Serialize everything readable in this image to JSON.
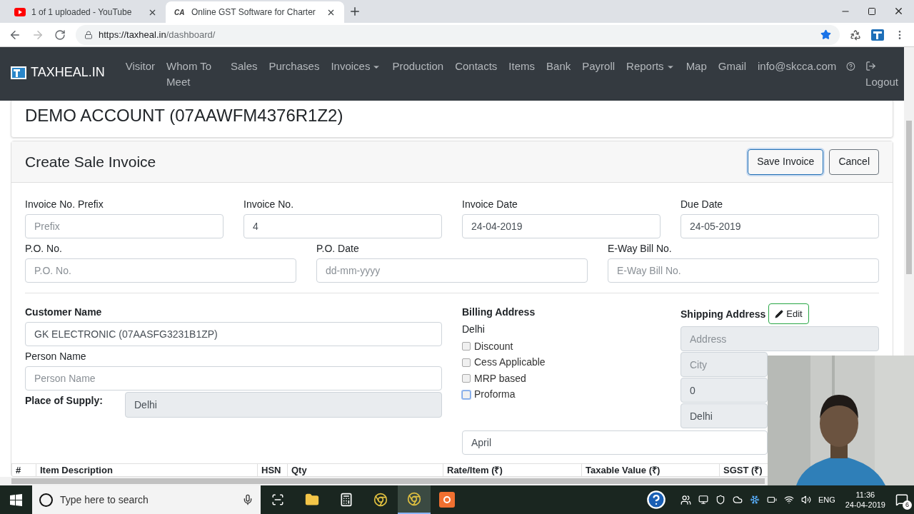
{
  "browser": {
    "tabs": [
      {
        "kind": "youtube",
        "title": "1 of 1 uploaded - YouTube",
        "selected": false
      },
      {
        "kind": "site",
        "favicon": "CA",
        "title": "Online GST Software for Charter",
        "selected": true
      }
    ],
    "address": {
      "host": "https://taxheal.in",
      "path": "/dashboard/"
    }
  },
  "navbar": {
    "brand": "TAXHEAL.IN",
    "items": [
      {
        "label": "Visitor",
        "dropdown": false
      },
      {
        "label": "Whom To Meet",
        "dropdown": false
      },
      {
        "label": "Sales",
        "dropdown": false
      },
      {
        "label": "Purchases",
        "dropdown": false
      },
      {
        "label": "Invoices",
        "dropdown": true
      },
      {
        "label": "Production",
        "dropdown": false
      },
      {
        "label": "Contacts",
        "dropdown": false
      },
      {
        "label": "Items",
        "dropdown": false
      },
      {
        "label": "Bank",
        "dropdown": false
      },
      {
        "label": "Payroll",
        "dropdown": false
      },
      {
        "label": "Reports",
        "dropdown": true
      },
      {
        "label": "Map",
        "dropdown": false
      },
      {
        "label": "Gmail",
        "dropdown": false
      },
      {
        "label": "info@skcca.com",
        "dropdown": false
      }
    ],
    "logout": "Logout"
  },
  "account_title": "DEMO ACCOUNT (07AAWFM4376R1Z2)",
  "invoice": {
    "title": "Create Sale Invoice",
    "buttons": [
      {
        "label": "Save Invoice",
        "kind": "primary"
      },
      {
        "label": "Cancel",
        "kind": "secondary"
      }
    ],
    "row_1": [
      {
        "label": "Invoice No. Prefix",
        "placeholder": "Prefix"
      },
      {
        "label": "Invoice No.",
        "value": "4"
      },
      {
        "label": "Invoice Date",
        "value": "24-04-2019"
      },
      {
        "label": "Due Date",
        "value": "24-05-2019"
      }
    ],
    "row_2": [
      {
        "label": "P.O. No.",
        "placeholder": "P.O. No."
      },
      {
        "label": "P.O. Date",
        "placeholder": "dd-mm-yyyy"
      },
      {
        "label": "E-Way Bill No.",
        "placeholder": "E-Way Bill No."
      }
    ],
    "customer": {
      "label": "Customer Name",
      "value": "GK ELECTRONIC (07AASFG3231B1ZP)",
      "person_label": "Person Name",
      "person_placeholder": "Person Name",
      "supply_label": "Place of Supply:",
      "supply_value": "Delhi"
    },
    "billing": {
      "label": "Billing Address",
      "address": "Delhi",
      "options": [
        {
          "label": "Discount",
          "checked": false,
          "focused": false
        },
        {
          "label": "Cess Applicable",
          "checked": false,
          "focused": false
        },
        {
          "label": "MRP based",
          "checked": false,
          "focused": false
        },
        {
          "label": "Proforma",
          "checked": false,
          "focused": true
        }
      ]
    },
    "shipping": {
      "label": "Shipping Address",
      "edit": "Edit",
      "fields": [
        {
          "placeholder": "Address"
        },
        {
          "placeholder": "City"
        },
        {
          "value": "0"
        },
        {
          "value": "Delhi"
        }
      ]
    },
    "month": "April",
    "table_columns": [
      "#",
      "Item Description",
      "HSN",
      "Qty",
      "Rate/Item (₹)",
      "Taxable Value (₹)",
      "SGST (₹)"
    ]
  },
  "taskbar": {
    "search_placeholder": "Type here to search",
    "language": "ENG",
    "time": "11:36",
    "date": "24-04-2019",
    "notifications": "6"
  }
}
